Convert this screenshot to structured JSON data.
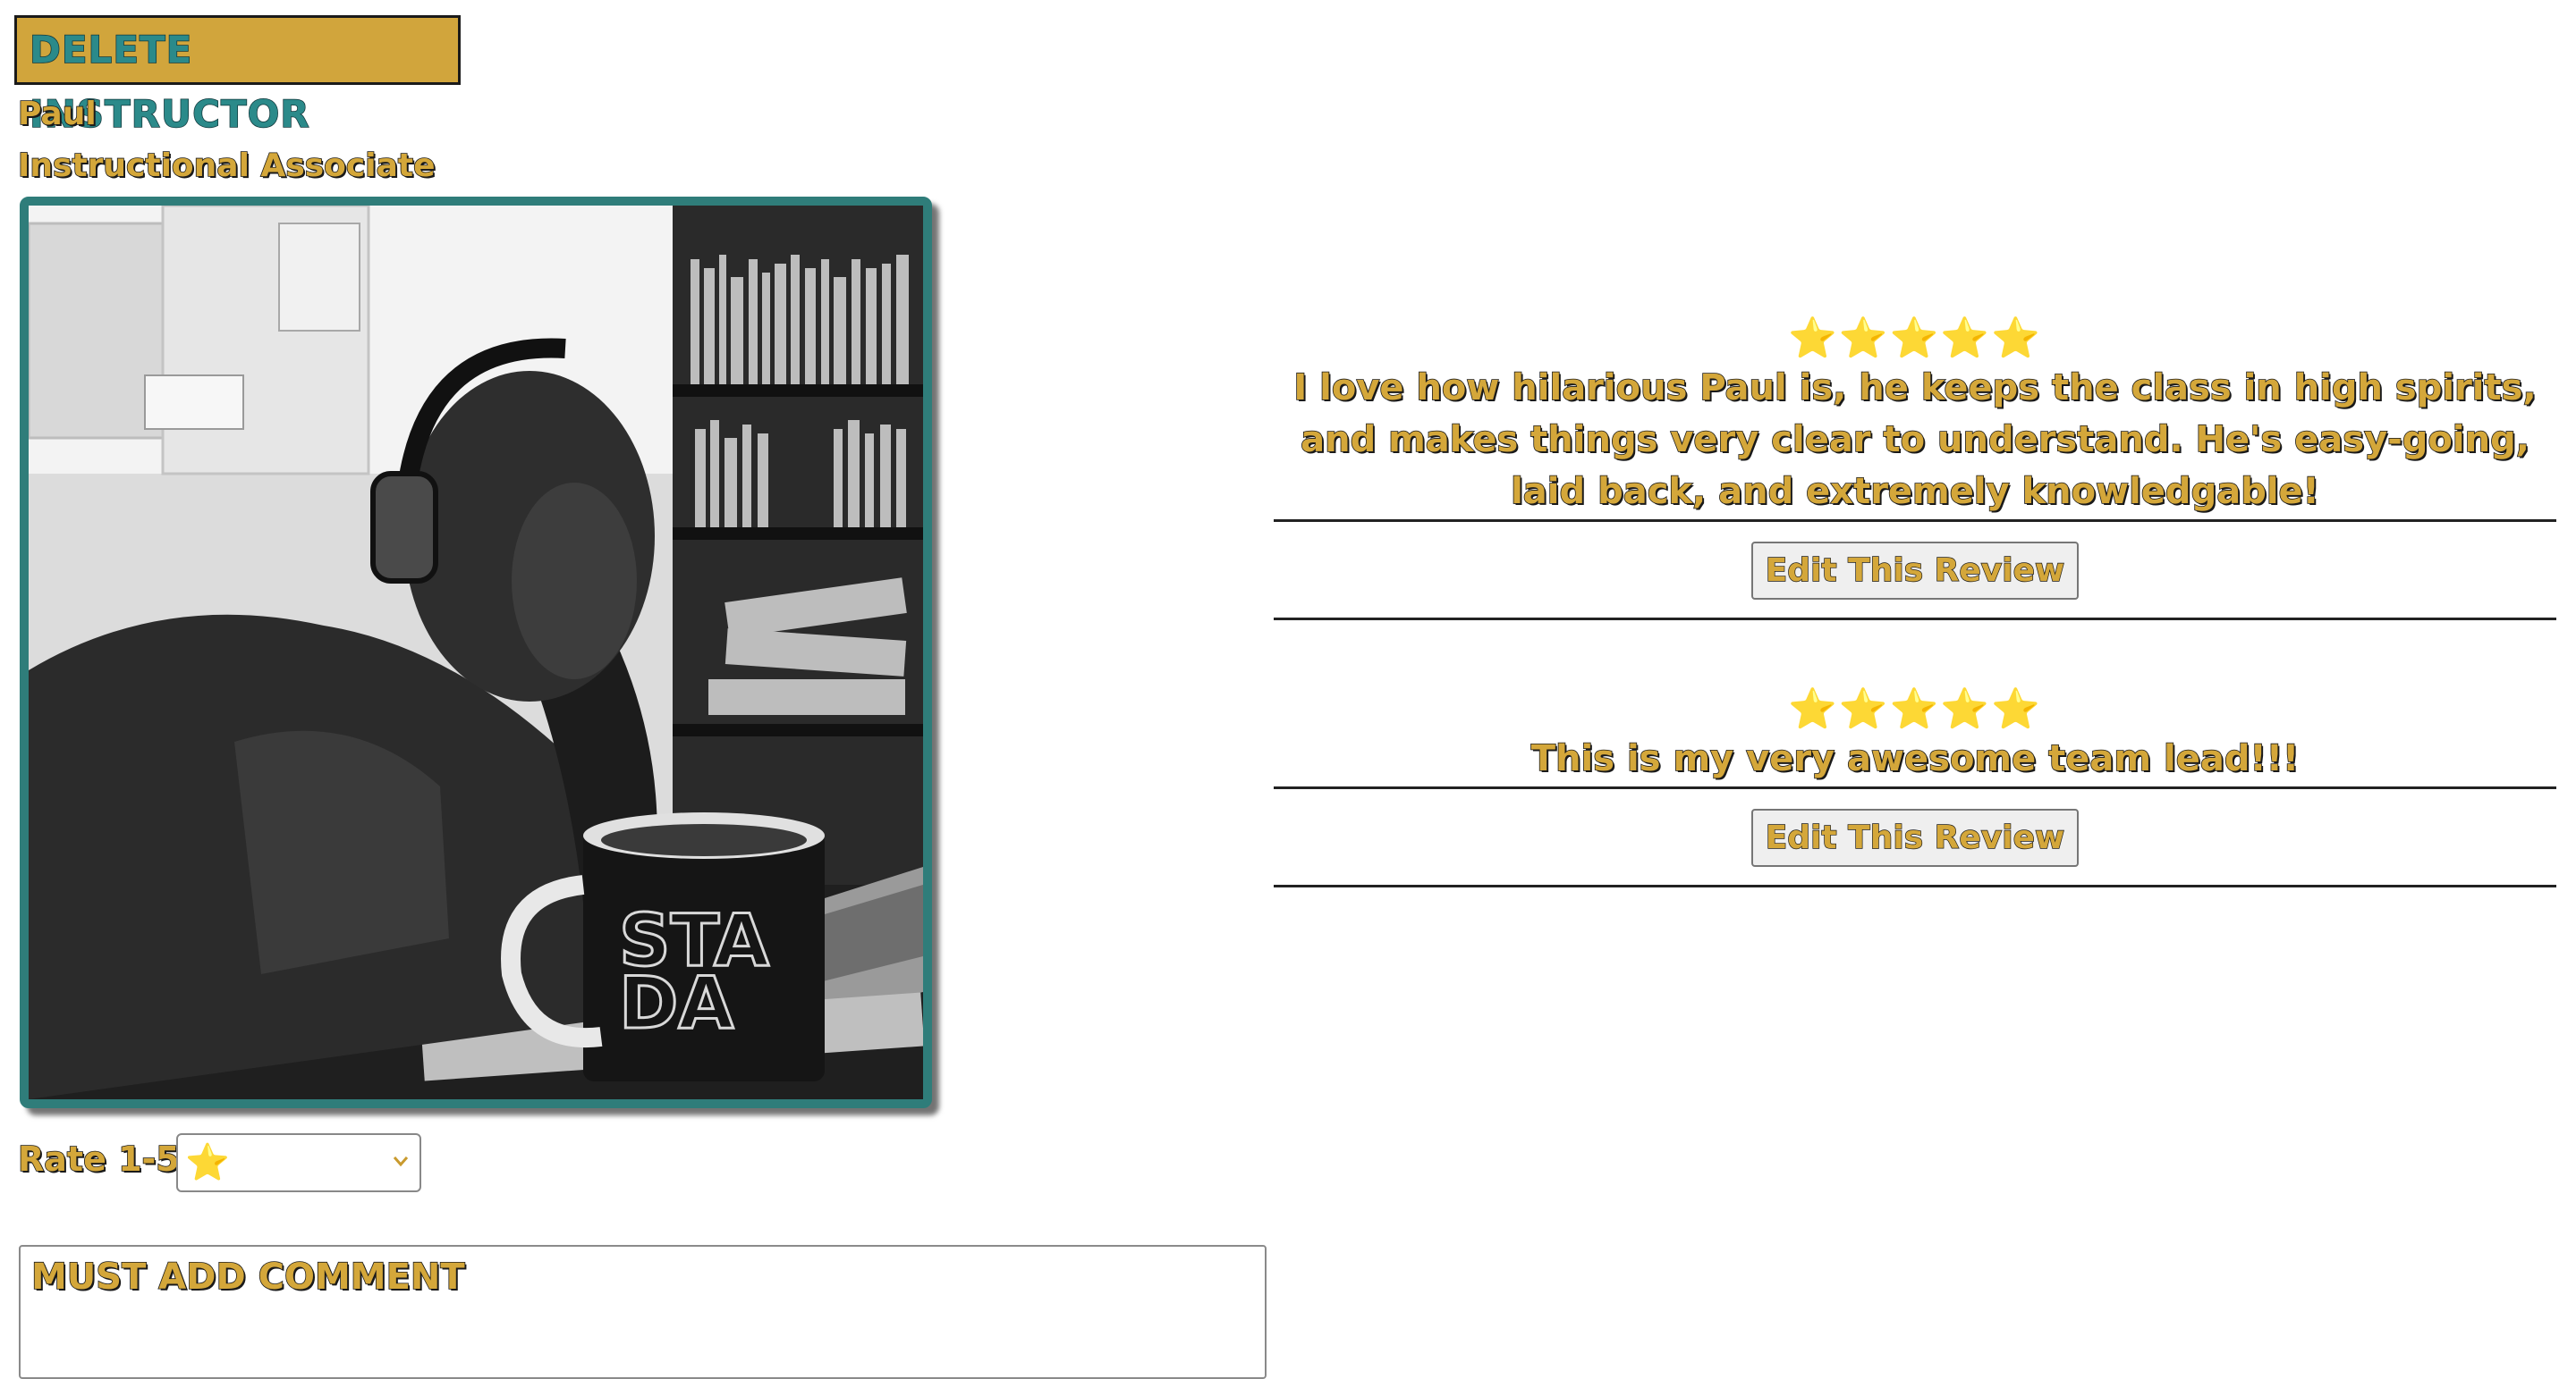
{
  "instructor": {
    "delete_label": "DELETE INSTRUCTOR",
    "name": "Paul",
    "role": "Instructional Associate"
  },
  "rating_form": {
    "label": "Rate 1-5",
    "selected": "⭐",
    "comment_placeholder": "MUST ADD COMMENT"
  },
  "reviews": [
    {
      "stars": "⭐⭐⭐⭐⭐",
      "text": "I love how hilarious Paul is, he keeps the class in high spirits, and makes things very clear to understand. He's easy-going, laid back, and extremely knowledgable!",
      "edit_label": "Edit This Review"
    },
    {
      "stars": "⭐⭐⭐⭐⭐",
      "text": "This is my very awesome team lead!!!",
      "edit_label": "Edit This Review"
    }
  ],
  "colors": {
    "accent_gold": "#d4a73a",
    "frame_teal": "#2f7d7a",
    "delete_text_teal": "#2b8a8a"
  }
}
